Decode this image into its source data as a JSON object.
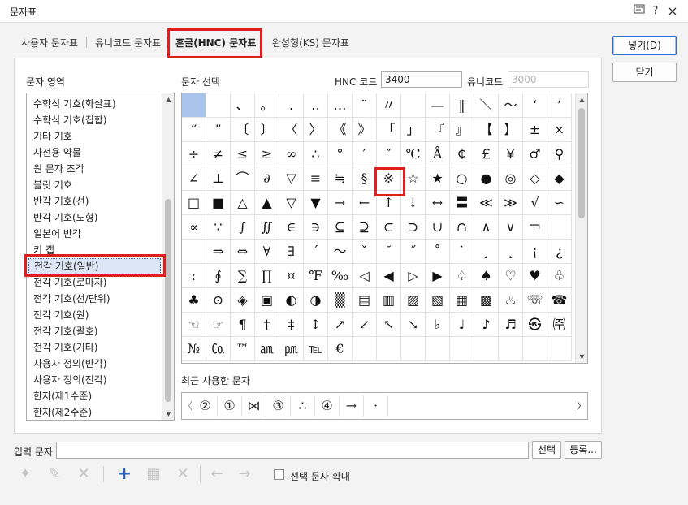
{
  "window": {
    "title": "문자표",
    "help_icon": "?",
    "close_icon": "×"
  },
  "tabs": [
    {
      "label": "사용자 문자표",
      "active": false
    },
    {
      "label": "유니코드 문자표",
      "active": false
    },
    {
      "label": "훈글(HNC) 문자표",
      "active": true
    },
    {
      "label": "완성형(KS) 문자표",
      "active": false
    }
  ],
  "area": {
    "label": "문자 영역",
    "items": [
      "수학식 기호(화살표)",
      "수학식 기호(집합)",
      "기타 기호",
      "사전용 약물",
      "원 문자 조각",
      "블릿 기호",
      "반각 기호(선)",
      "반각 기호(도형)",
      "일본어 반각",
      "키 캡",
      "전각 기호(일반)",
      "전각 기호(로마자)",
      "전각 기호(선/단위)",
      "전각 기호(원)",
      "전각 기호(괄호)",
      "전각 기호(기타)",
      "사용자 정의(반각)",
      "사용자 정의(전각)",
      "한자(제1수준)",
      "한자(제2수준)"
    ],
    "selected_index": 10
  },
  "selection": {
    "label": "문자 선택",
    "hnc_label": "HNC 코드",
    "hnc_value": "3400",
    "unicode_label": "유니코드",
    "unicode_value": "3000"
  },
  "grid": {
    "rows": [
      [
        "",
        "",
        "、",
        "。",
        ".",
        "‥",
        "…",
        "¨",
        "〃",
        "",
        "—",
        "‖",
        "＼",
        "～",
        "‘",
        "’"
      ],
      [
        "“",
        "”",
        "〔",
        "〕",
        "〈",
        "〉",
        "《",
        "》",
        "「",
        "」",
        "『",
        "』",
        "【",
        "】",
        "±",
        "×"
      ],
      [
        "÷",
        "≠",
        "≤",
        "≥",
        "∞",
        "∴",
        "°",
        "′",
        "″",
        "℃",
        "Å",
        "￠",
        "￡",
        "￥",
        "♂",
        "♀"
      ],
      [
        "∠",
        "⊥",
        "⌒",
        "∂",
        "▽",
        "≡",
        "≒",
        "§",
        "※",
        "☆",
        "★",
        "○",
        "●",
        "◎",
        "◇",
        "◆"
      ],
      [
        "□",
        "■",
        "△",
        "▲",
        "▽",
        "▼",
        "→",
        "←",
        "↑",
        "↓",
        "↔",
        "〓",
        "≪",
        "≫",
        "√",
        "∽"
      ],
      [
        "∝",
        "∵",
        "∫",
        "∬",
        "∈",
        "∋",
        "⊆",
        "⊇",
        "⊂",
        "⊃",
        "∪",
        "∩",
        "∧",
        "∨",
        "￢",
        ""
      ],
      [
        "",
        "⇒",
        "⇔",
        "∀",
        "∃",
        "´",
        "～",
        "ˇ",
        "˘",
        "˝",
        "˚",
        "˙",
        "¸",
        "˛",
        "¡",
        "¿"
      ],
      [
        "ː",
        "∮",
        "∑",
        "∏",
        "¤",
        "℉",
        "‰",
        "◁",
        "◀",
        "▷",
        "▶",
        "♤",
        "♠",
        "♡",
        "♥",
        "♧"
      ],
      [
        "♣",
        "⊙",
        "◈",
        "▣",
        "◐",
        "◑",
        "▒",
        "▤",
        "▥",
        "▨",
        "▧",
        "▦",
        "▩",
        "♨",
        "☏",
        "☎"
      ],
      [
        "☜",
        "☞",
        "¶",
        "†",
        "‡",
        "↕",
        "↗",
        "↙",
        "↖",
        "↘",
        "♭",
        "♩",
        "♪",
        "♬",
        "㉿",
        "㈜"
      ],
      [
        "№",
        "㏇",
        "™",
        "㏂",
        "㏘",
        "℡",
        "€",
        "",
        "",
        "",
        "",
        "",
        "",
        "",
        "",
        ""
      ]
    ],
    "selected": {
      "row": 0,
      "col": 0
    },
    "highlight": {
      "row": 3,
      "col": 8
    }
  },
  "recent": {
    "label": "최근 사용한 문자",
    "chars": [
      "②",
      "①",
      "⋈",
      "③",
      "∴",
      "④",
      "→",
      "·"
    ],
    "left_arrow": "〈",
    "right_arrow": "〉"
  },
  "input": {
    "label": "입력 문자",
    "value": "",
    "select_button": "선택",
    "register_button": "등록..."
  },
  "buttons": {
    "insert": "넣기(D)",
    "close": "닫기"
  },
  "toolbar": {
    "enlarge_label": "선택 문자 확대",
    "enlarge_checked": false
  },
  "colors": {
    "highlight_red": "#e01e1e",
    "selected_cell": "#a8c3ec",
    "accent": "#2f5fb0"
  }
}
